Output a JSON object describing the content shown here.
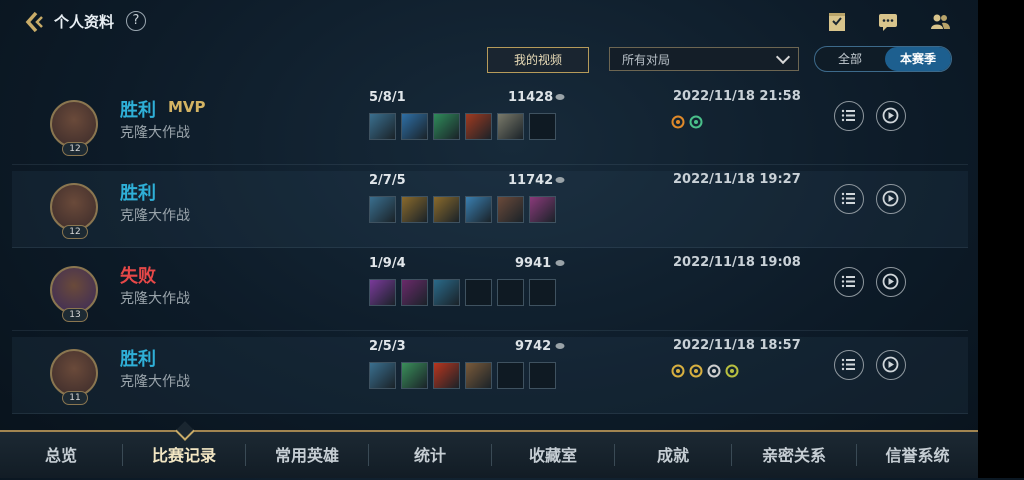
{
  "header": {
    "title": "个人资料",
    "help_glyph": "?"
  },
  "toolbar": {
    "video_button": "我的视频",
    "filter_value": "所有对局",
    "segments": [
      "全部",
      "本赛季"
    ],
    "active_segment": "本赛季"
  },
  "colors": {
    "win": "#2fb0d8",
    "lose": "#e64848",
    "accent": "#c9ac68"
  },
  "matches": [
    {
      "result": "胜利",
      "mvp": "MVP",
      "mode": "克隆大作战",
      "level": "12",
      "kda": "5/8/1",
      "gold": "11428",
      "date": "2022/11/18 21:58",
      "outcome": "win"
    },
    {
      "result": "胜利",
      "mvp": "",
      "mode": "克隆大作战",
      "level": "12",
      "kda": "2/7/5",
      "gold": "11742",
      "date": "2022/11/18 19:27",
      "outcome": "win"
    },
    {
      "result": "失败",
      "mvp": "",
      "mode": "克隆大作战",
      "level": "13",
      "kda": "1/9/4",
      "gold": "9941",
      "date": "2022/11/18 19:08",
      "outcome": "lose"
    },
    {
      "result": "胜利",
      "mvp": "",
      "mode": "克隆大作战",
      "level": "11",
      "kda": "2/5/3",
      "gold": "9742",
      "date": "2022/11/18 18:57",
      "outcome": "win"
    }
  ],
  "bottom_nav": [
    "总览",
    "比赛记录",
    "常用英雄",
    "统计",
    "收藏室",
    "成就",
    "亲密关系",
    "信誉系统"
  ],
  "active_nav": "比赛记录"
}
